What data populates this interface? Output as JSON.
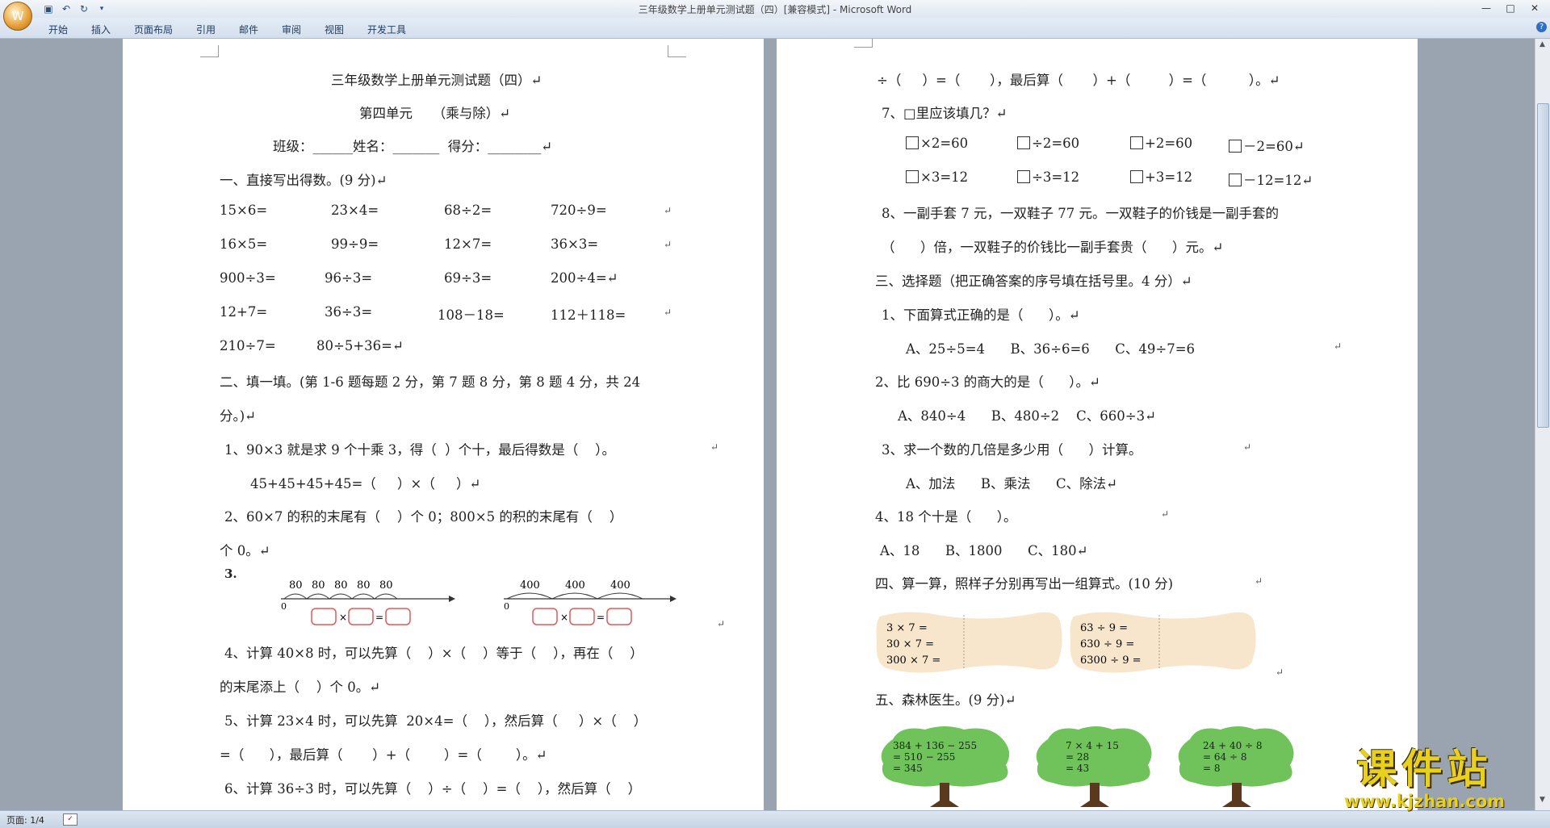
{
  "window": {
    "title": "三年级数学上册单元测试题（四）[兼容模式] - Microsoft Word",
    "controls": [
      "—",
      "□",
      "✕"
    ]
  },
  "ribbon": {
    "tabs": [
      "开始",
      "插入",
      "页面布局",
      "引用",
      "邮件",
      "审阅",
      "视图",
      "开发工具"
    ],
    "help": "?"
  },
  "status": {
    "page": "页面: 1/4"
  },
  "watermark": {
    "main": "课件站",
    "url": "www.kjzhan.com"
  },
  "page1": {
    "title": "三年级数学上册单元测试题（四）↵",
    "unit": "第四单元　　（乘与除）↵",
    "info": "班级：______姓名：_______  得分：________↵",
    "s1_heading": "一、直接写出得数。(9 分)↵",
    "calc": [
      [
        "15×6=",
        "23×4=",
        "68÷2=",
        "720÷9="
      ],
      [
        "16×5=",
        "99÷9=",
        "12×7=",
        "36×3="
      ],
      [
        "900÷3=",
        "96÷3=",
        "69÷3=",
        "200÷4=↵"
      ],
      [
        "12+7=",
        "36÷3=",
        "108－18=",
        "112＋118="
      ],
      [
        "210÷7=",
        "80÷5+36=↵"
      ]
    ],
    "s2_heading_1": "二、填一填。(第 1-6 题每题 2 分，第 7 题 8 分，第 8 题 4 分，共 24",
    "s2_heading_2": "分。)↵",
    "q1_a": "1、90×3 就是求 9 个十乘 3，得（  ）个十，最后得数是（    ）。",
    "q1_b": "45+45+45+45=（     ）×（     ）↵",
    "q2_a": "2、60×7 的积的末尾有（    ）个 0；800×5 的积的末尾有（    ）",
    "q2_b": "个 0。↵",
    "q3_label": "3.",
    "nl1_values": [
      "80",
      "80",
      "80",
      "80",
      "80"
    ],
    "nl2_values": [
      "400",
      "400",
      "400"
    ],
    "nl_zero": "0",
    "q4_a": "4、计算 40×8 时，可以先算（    ）×（    ）等于（    ），再在（    ）",
    "q4_b": "的末尾添上（    ）个 0。↵",
    "q5_a": "5、计算 23×4 时，可以先算  20×4=（    ），然后算（     ）×（    ）",
    "q5_b": "=（      ），最后算（       ）+（        ）=（        ）。↵",
    "q6_a": "6、计算 36÷3 时，可以先算（    ）÷（    ）=（    ），然后算（    ）",
    "para": "↵"
  },
  "page2": {
    "cont": "÷（     ）=（       ），最后算（       ）+（         ）=（          ）。↵",
    "q7": "7、□里应该填几？↵",
    "q7_r1": [
      "×2=60",
      "÷2=60",
      "+2=60",
      "－2=60↵"
    ],
    "q7_r2": [
      "×3=12",
      "÷3=12",
      "+3=12",
      "－12=12↵"
    ],
    "q8_a": "8、一副手套 7 元，一双鞋子 77 元。一双鞋子的价钱是一副手套的",
    "q8_b": "（      ）倍，一双鞋子的价钱比一副手套贵（      ）元。↵",
    "s3": "三、选择题（把正确答案的序号填在括号里。4 分）↵",
    "c1": "1、下面算式正确的是（      ）。↵",
    "c1_opts": "A、25÷5=4      B、36÷6=6      C、49÷7=6",
    "c2": "2、比 690÷3 的商大的是（      ）。↵",
    "c2_opts": "A、840÷4      B、480÷2    C、660÷3↵",
    "c3": "3、求一个数的几倍是多少用（      ）计算。",
    "c3_opts": "A、加法      B、乘法      C、除法↵",
    "c4": "4、18 个十是（      ）。",
    "c4_opts": "A、18      B、1800      C、180↵",
    "s4": "四、算一算，照样子分别再写出一组算式。(10 分)",
    "card1": [
      "3 × 7 =",
      "30 × 7 =",
      "300 × 7 ="
    ],
    "card2": [
      "63 ÷ 9 =",
      "630 ÷ 9 =",
      "6300 ÷ 9 ="
    ],
    "s5": "五、森林医生。(9 分)↵",
    "tree1": [
      "384 + 136 − 255",
      "= 510 − 255",
      "= 345"
    ],
    "tree2": [
      "7 × 4 + 15",
      "= 28",
      "= 43"
    ],
    "tree3": [
      "24 + 40 ÷ 8",
      "= 64 ÷ 8",
      "= 8"
    ],
    "para": "↵"
  },
  "colors": {
    "card_bg": "#f8e6cc",
    "tree_green": "#6fc35a",
    "tree_trunk": "#5a3a1e",
    "watermark": "#e7d11e"
  },
  "icons": [
    "office-button-icon",
    "save-icon",
    "undo-icon",
    "redo-icon",
    "customize-icon",
    "help-icon",
    "proofing-icon"
  ]
}
